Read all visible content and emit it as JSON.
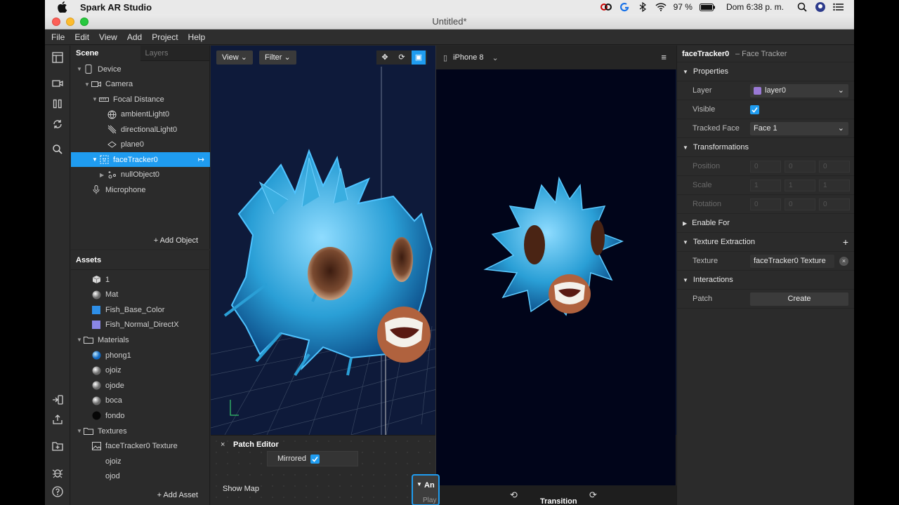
{
  "menubar": {
    "app_name": "Spark AR Studio",
    "battery": "97 %",
    "clock": "Dom 6:38 p. m."
  },
  "window": {
    "title": "Untitled*"
  },
  "app_menu": [
    "File",
    "Edit",
    "View",
    "Add",
    "Project",
    "Help"
  ],
  "scene": {
    "tabs": [
      "Scene",
      "Layers"
    ],
    "tree": [
      {
        "label": "Device",
        "icon": "phone-icon",
        "depth": 0,
        "arrow": "down"
      },
      {
        "label": "Camera",
        "icon": "camera-icon",
        "depth": 1,
        "arrow": "down"
      },
      {
        "label": "Focal Distance",
        "icon": "focal-distance-icon",
        "depth": 2,
        "arrow": "down"
      },
      {
        "label": "ambientLight0",
        "icon": "globe-light-icon",
        "depth": 3,
        "arrow": ""
      },
      {
        "label": "directionalLight0",
        "icon": "directional-light-icon",
        "depth": 3,
        "arrow": ""
      },
      {
        "label": "plane0",
        "icon": "plane-icon",
        "depth": 3,
        "arrow": ""
      },
      {
        "label": "faceTracker0",
        "icon": "face-tracker-icon",
        "depth": 2,
        "arrow": "down",
        "selected": true
      },
      {
        "label": "nullObject0",
        "icon": "null-object-icon",
        "depth": 3,
        "arrow": "right"
      },
      {
        "label": "Microphone",
        "icon": "microphone-icon",
        "depth": 1,
        "arrow": ""
      }
    ],
    "add_object": "Add Object"
  },
  "assets": {
    "title": "Assets",
    "items": [
      {
        "label": "1",
        "icon": "cube-icon",
        "depth": 1
      },
      {
        "label": "Mat",
        "icon": "sphere-gray-icon",
        "depth": 1
      },
      {
        "label": "Fish_Base_Color",
        "icon": "texture-blue-icon",
        "depth": 1
      },
      {
        "label": "Fish_Normal_DirectX",
        "icon": "texture-purple-icon",
        "depth": 1
      },
      {
        "label": "Materials",
        "icon": "folder-icon",
        "depth": 0,
        "arrow": "down"
      },
      {
        "label": "phong1",
        "icon": "sphere-blue-icon",
        "depth": 1
      },
      {
        "label": "ojoiz",
        "icon": "sphere-gray-icon",
        "depth": 1
      },
      {
        "label": "ojode",
        "icon": "sphere-gray-icon",
        "depth": 1
      },
      {
        "label": "boca",
        "icon": "sphere-gray-icon",
        "depth": 1
      },
      {
        "label": "fondo",
        "icon": "sphere-black-icon",
        "depth": 1
      },
      {
        "label": "Textures",
        "icon": "folder-icon",
        "depth": 0,
        "arrow": "down"
      },
      {
        "label": "faceTracker0 Texture",
        "icon": "texture-icon",
        "depth": 1
      },
      {
        "label": "ojoiz",
        "icon": "",
        "depth": 1
      },
      {
        "label": "ojod",
        "icon": "",
        "depth": 1
      }
    ],
    "add_asset": "Add Asset"
  },
  "viewport": {
    "view_label": "View",
    "filter_label": "Filter"
  },
  "simulator": {
    "device": "iPhone 8"
  },
  "patch_editor": {
    "title": "Patch Editor",
    "mirrored_label": "Mirrored",
    "show_map": "Show Map",
    "node_partial": "An",
    "play_partial": "Play",
    "transition_partial": "Transition"
  },
  "inspector": {
    "object_name": "faceTracker0",
    "object_type": "– Face Tracker",
    "sections": {
      "properties": "Properties",
      "transformations": "Transformations",
      "enable_for": "Enable For",
      "texture_extraction": "Texture Extraction",
      "interactions": "Interactions"
    },
    "layer_label": "Layer",
    "layer_value": "layer0",
    "visible_label": "Visible",
    "tracked_face_label": "Tracked Face",
    "tracked_face_value": "Face 1",
    "position_label": "Position",
    "position": [
      "0",
      "0",
      "0"
    ],
    "scale_label": "Scale",
    "scale": [
      "1",
      "1",
      "1"
    ],
    "rotation_label": "Rotation",
    "rotation": [
      "0",
      "0",
      "0"
    ],
    "texture_label": "Texture",
    "texture_value": "faceTracker0 Texture",
    "patch_label": "Patch",
    "create_button": "Create"
  },
  "colors": {
    "accent": "#1f9cf0",
    "fish": "#2aa3d8",
    "viewport_bg": "#0e1a3a"
  }
}
